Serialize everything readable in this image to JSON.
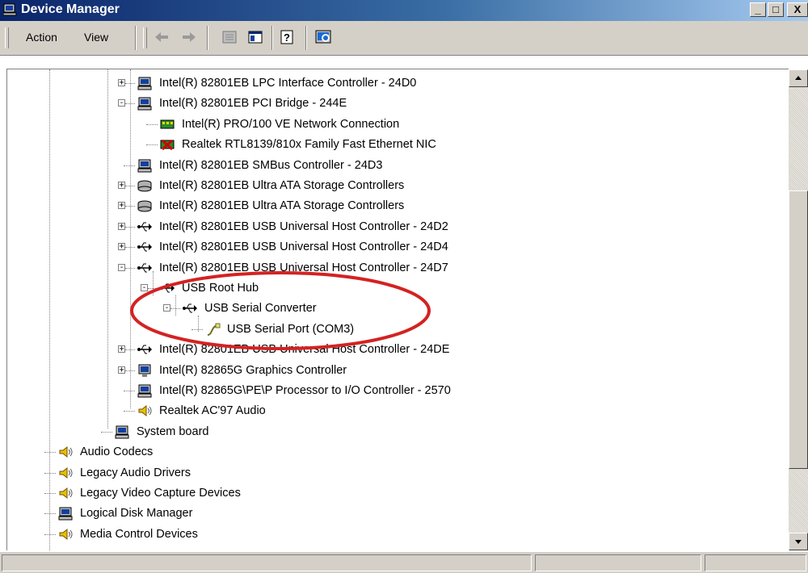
{
  "window": {
    "title": "Device Manager",
    "minimize": "_",
    "maximize": "□",
    "close": "X"
  },
  "menu": {
    "action": "Action",
    "view": "View"
  },
  "toolbar": [
    "back-icon",
    "forward-icon",
    "properties-icon",
    "console-tree-icon",
    "help-icon",
    "scan-hardware-icon"
  ],
  "tree": [
    {
      "label": "Intel(R) 82801EB LPC Interface Controller - 24D0",
      "icon": "computer-icon",
      "expander": "+"
    },
    {
      "label": "Intel(R) 82801EB PCI Bridge - 244E",
      "icon": "computer-icon",
      "expander": "-"
    },
    {
      "label": "Intel(R) PRO/100 VE Network Connection",
      "icon": "network-card-icon",
      "expander": ""
    },
    {
      "label": "Realtek RTL8139/810x Family Fast Ethernet NIC",
      "icon": "network-card-disabled-icon",
      "expander": ""
    },
    {
      "label": "Intel(R) 82801EB SMBus Controller - 24D3",
      "icon": "computer-icon",
      "expander": ""
    },
    {
      "label": "Intel(R) 82801EB Ultra ATA Storage Controllers",
      "icon": "disk-controller-icon",
      "expander": "+"
    },
    {
      "label": "Intel(R) 82801EB Ultra ATA Storage Controllers",
      "icon": "disk-controller-icon",
      "expander": "+"
    },
    {
      "label": "Intel(R) 82801EB USB Universal Host Controller - 24D2",
      "icon": "usb-icon",
      "expander": "+"
    },
    {
      "label": "Intel(R) 82801EB USB Universal Host Controller - 24D4",
      "icon": "usb-icon",
      "expander": "+"
    },
    {
      "label": "Intel(R) 82801EB USB Universal Host Controller - 24D7",
      "icon": "usb-icon",
      "expander": "-"
    },
    {
      "label": "USB Root Hub",
      "icon": "usb-icon",
      "expander": "-"
    },
    {
      "label": "USB Serial Converter",
      "icon": "usb-icon",
      "expander": "-"
    },
    {
      "label": "USB Serial Port (COM3)",
      "icon": "serial-port-icon",
      "expander": ""
    },
    {
      "label": "Intel(R) 82801EB USB Universal Host Controller - 24DE",
      "icon": "usb-icon",
      "expander": "+"
    },
    {
      "label": "Intel(R) 82865G Graphics Controller",
      "icon": "display-icon",
      "expander": "+"
    },
    {
      "label": "Intel(R) 82865G\\PE\\P Processor to I/O Controller - 2570",
      "icon": "computer-icon",
      "expander": ""
    },
    {
      "label": "Realtek AC'97 Audio",
      "icon": "speaker-icon",
      "expander": ""
    },
    {
      "label": "System board",
      "icon": "computer-icon",
      "expander": ""
    },
    {
      "label": "Audio Codecs",
      "icon": "speaker-icon",
      "expander": ""
    },
    {
      "label": "Legacy Audio Drivers",
      "icon": "speaker-icon",
      "expander": ""
    },
    {
      "label": "Legacy Video Capture Devices",
      "icon": "speaker-icon",
      "expander": ""
    },
    {
      "label": "Logical Disk Manager",
      "icon": "computer-icon",
      "expander": ""
    },
    {
      "label": "Media Control Devices",
      "icon": "speaker-icon",
      "expander": ""
    }
  ],
  "highlight_color": "#d42222",
  "colors": {
    "titlebar_start": "#0a246a",
    "titlebar_end": "#a6caf0",
    "chrome": "#d4d0c8"
  }
}
